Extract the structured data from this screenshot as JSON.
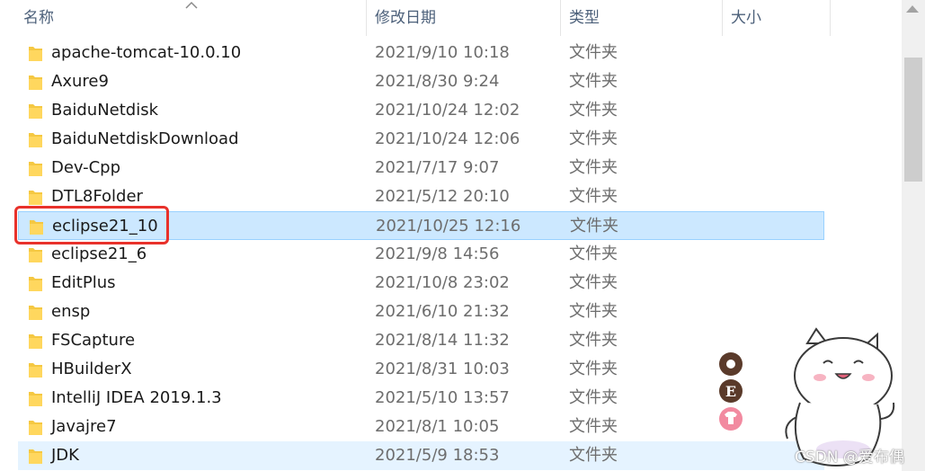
{
  "columns": {
    "name": "名称",
    "modified": "修改日期",
    "type": "类型",
    "size": "大小"
  },
  "colors": {
    "selected_bg": "#cce8ff",
    "hover_bg": "#e5f3ff",
    "highlight": "#e8312b",
    "folder": "#f5c842"
  },
  "rows": [
    {
      "name": "apache-tomcat-10.0.10",
      "modified": "2021/9/10 10:18",
      "type": "文件夹"
    },
    {
      "name": "Axure9",
      "modified": "2021/8/30 9:24",
      "type": "文件夹"
    },
    {
      "name": "BaiduNetdisk",
      "modified": "2021/10/24 12:02",
      "type": "文件夹"
    },
    {
      "name": "BaiduNetdiskDownload",
      "modified": "2021/10/24 12:06",
      "type": "文件夹"
    },
    {
      "name": "Dev-Cpp",
      "modified": "2021/7/17 9:07",
      "type": "文件夹"
    },
    {
      "name": "DTL8Folder",
      "modified": "2021/5/12 20:10",
      "type": "文件夹"
    },
    {
      "name": "eclipse21_10",
      "modified": "2021/10/25 12:16",
      "type": "文件夹",
      "state": "selected"
    },
    {
      "name": "eclipse21_6",
      "modified": "2021/9/8 14:56",
      "type": "文件夹"
    },
    {
      "name": "EditPlus",
      "modified": "2021/10/8 23:02",
      "type": "文件夹"
    },
    {
      "name": "ensp",
      "modified": "2021/6/10 21:32",
      "type": "文件夹"
    },
    {
      "name": "FSCapture",
      "modified": "2021/8/14 11:32",
      "type": "文件夹"
    },
    {
      "name": "HBuilderX",
      "modified": "2021/8/31 10:03",
      "type": "文件夹"
    },
    {
      "name": "IntelliJ IDEA 2019.1.3",
      "modified": "2021/5/10 13:57",
      "type": "文件夹"
    },
    {
      "name": "Javajre7",
      "modified": "2021/8/1 10:05",
      "type": "文件夹"
    },
    {
      "name": "JDK",
      "modified": "2021/5/9 18:53",
      "type": "文件夹",
      "state": "hover"
    }
  ],
  "sticker": {
    "badge_letter": "E"
  },
  "watermark": "CSDN @爱布偶"
}
